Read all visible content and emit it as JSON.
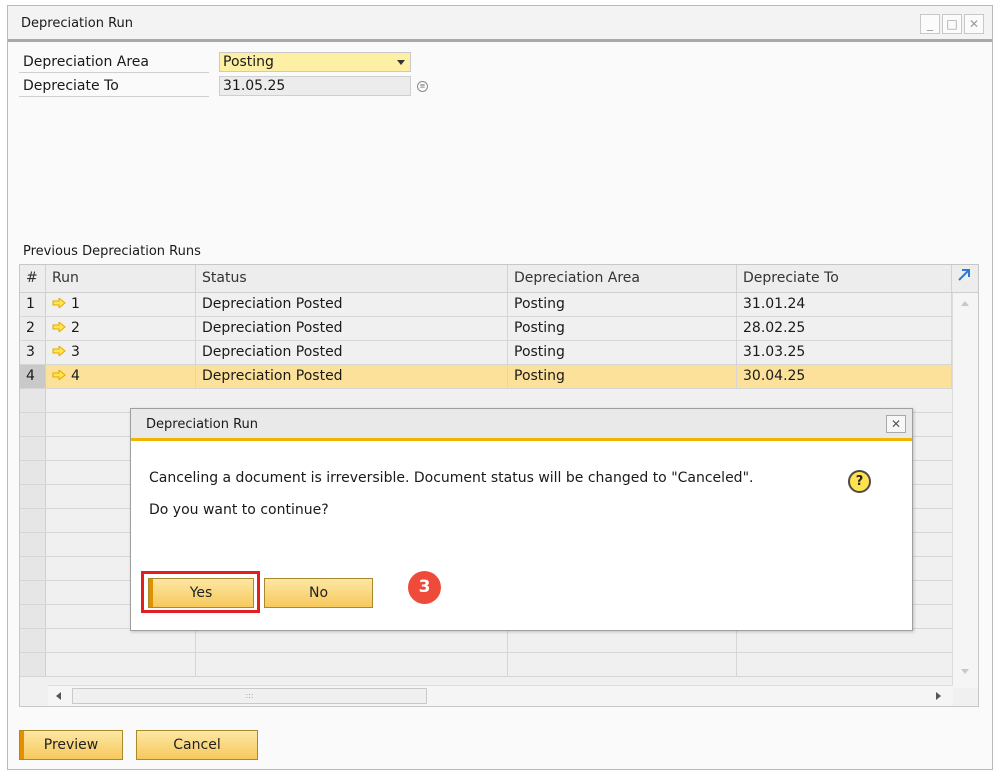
{
  "window": {
    "title": "Depreciation Run"
  },
  "form": {
    "area_label": "Depreciation Area",
    "area_value": "Posting",
    "to_label": "Depreciate To",
    "to_value": "31.05.25"
  },
  "grid": {
    "section_label": "Previous Depreciation Runs",
    "headers": {
      "num": "#",
      "run": "Run",
      "status": "Status",
      "area": "Depreciation Area",
      "to": "Depreciate To"
    },
    "rows": [
      {
        "num": "1",
        "run": "1",
        "status": "Depreciation Posted",
        "area": "Posting",
        "to": "31.01.24"
      },
      {
        "num": "2",
        "run": "2",
        "status": "Depreciation Posted",
        "area": "Posting",
        "to": "28.02.25"
      },
      {
        "num": "3",
        "run": "3",
        "status": "Depreciation Posted",
        "area": "Posting",
        "to": "31.03.25"
      },
      {
        "num": "4",
        "run": "4",
        "status": "Depreciation Posted",
        "area": "Posting",
        "to": "30.04.25"
      }
    ],
    "selected_row": 4
  },
  "buttons": {
    "preview": "Preview",
    "cancel": "Cancel"
  },
  "dialog": {
    "title": "Depreciation Run",
    "message": "Canceling a document is irreversible. Document status will be changed to \"Canceled\".",
    "question": "Do you want to continue?",
    "yes": "Yes",
    "no": "No",
    "icon": "question-icon"
  },
  "annotation": {
    "step": "3"
  },
  "colors": {
    "selection": "#fbe19a",
    "button": "#f6c95c",
    "accent": "#e28f00",
    "highlight": "#e41e1e",
    "step_badge": "#ef4b3b"
  }
}
